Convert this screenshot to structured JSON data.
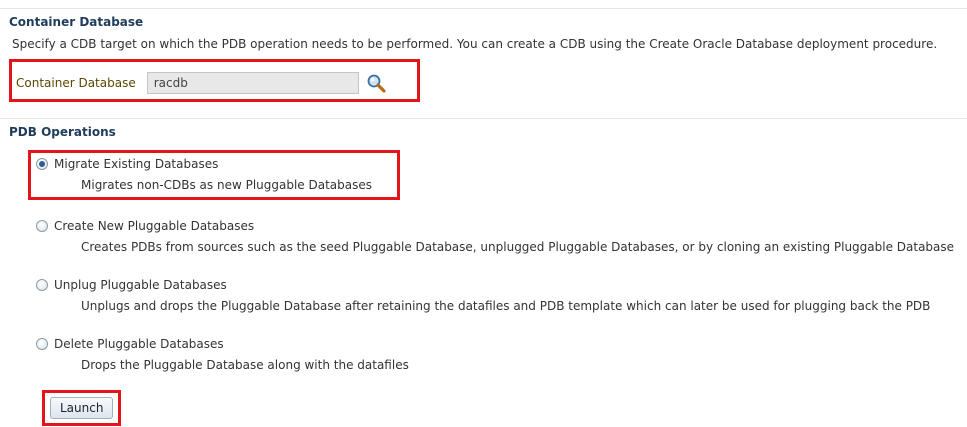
{
  "container_section": {
    "title": "Container Database",
    "description": "Specify a CDB target on which the PDB operation needs to be performed. You can create a CDB using the Create Oracle Database deployment procedure.",
    "field_label": "Container Database",
    "field_value": "racdb"
  },
  "pdb_section": {
    "title": "PDB Operations",
    "options": [
      {
        "label": "Migrate Existing Databases",
        "description": "Migrates non-CDBs as new Pluggable Databases",
        "selected": true
      },
      {
        "label": "Create New Pluggable Databases",
        "description": "Creates PDBs from sources such as the seed Pluggable Database, unplugged Pluggable Databases, or by cloning an existing Pluggable Database",
        "selected": false
      },
      {
        "label": "Unplug Pluggable Databases",
        "description": "Unplugs and drops the Pluggable Database after retaining the datafiles and PDB template which can later be used for plugging back the PDB",
        "selected": false
      },
      {
        "label": "Delete Pluggable Databases",
        "description": "Drops the Pluggable Database along with the datafiles",
        "selected": false
      }
    ]
  },
  "launch_label": "Launch",
  "highlight_color": "#e3151a"
}
